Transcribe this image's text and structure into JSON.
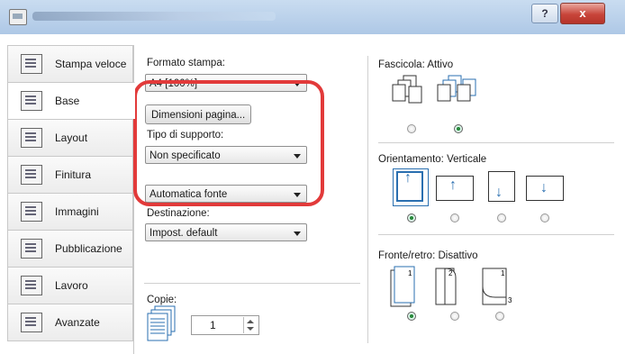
{
  "window": {
    "help_label": "?",
    "close_label": "x"
  },
  "tabs": [
    {
      "label": "Stampa veloce",
      "icon": "quick-print-icon"
    },
    {
      "label": "Base",
      "icon": "basic-icon",
      "active": true
    },
    {
      "label": "Layout",
      "icon": "layout-icon"
    },
    {
      "label": "Finitura",
      "icon": "finishing-icon"
    },
    {
      "label": "Immagini",
      "icon": "imaging-icon"
    },
    {
      "label": "Pubblicazione",
      "icon": "publishing-icon"
    },
    {
      "label": "Lavoro",
      "icon": "job-icon"
    },
    {
      "label": "Avanzate",
      "icon": "advanced-icon"
    }
  ],
  "basic": {
    "print_size_label": "Formato stampa:",
    "print_size_value": "A4  [100%]",
    "page_size_button": "Dimensioni pagina...",
    "media_type_label": "Tipo di supporto:",
    "media_type_value": "Non specificato",
    "source_value": "Automatica fonte",
    "destination_label": "Destinazione:",
    "destination_value": "Impost. default",
    "copies_label": "Copie:",
    "copies_value": "1"
  },
  "right": {
    "collate_label": "Fascicola:",
    "collate_value": "Attivo",
    "orientation_label": "Orientamento:",
    "orientation_value": "Verticale",
    "duplex_label": "Fronte/retro:",
    "duplex_value": "Disattivo"
  },
  "colors": {
    "highlight": "#e23a3a",
    "accent": "#2a6fb0",
    "radio_on": "#2c8a3f"
  }
}
